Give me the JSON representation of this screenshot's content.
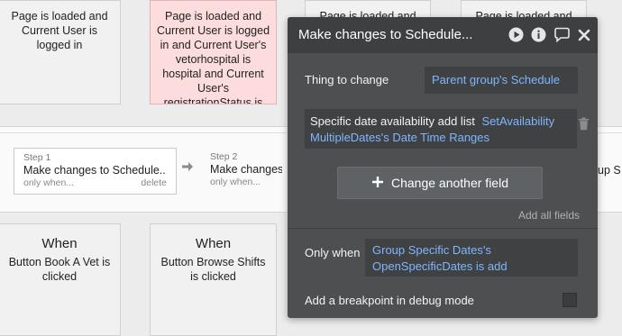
{
  "workflow": {
    "cards_top": [
      {
        "text": "Page is loaded and Current User is logged in",
        "highlight": false
      },
      {
        "text": "Page is loaded and Current User is logged in and Current User's vetorhospital is hospital and Current User's registrationStatus is",
        "highlight": true
      },
      {
        "text": "Page is loaded and",
        "highlight": false
      },
      {
        "text": "Page is loaded and",
        "highlight": false
      }
    ],
    "cards_bottom": [
      {
        "when": "When",
        "event": "Button Book A Vet is clicked"
      },
      {
        "when": "When",
        "event": "Button Browse Shifts is clicked"
      }
    ],
    "steps": [
      {
        "label": "Step 1",
        "name": "Make changes to Schedule...",
        "condition": "only when...",
        "action": "delete"
      },
      {
        "label": "Step 2",
        "name": "Make changes t",
        "condition": "only when..."
      }
    ],
    "right_edge_text": "up S"
  },
  "panel": {
    "title": "Make changes to Schedule...",
    "icons": [
      "play-icon",
      "info-icon",
      "comment-icon",
      "close-icon"
    ],
    "thing_to_change_label": "Thing to change",
    "thing_to_change_value": "Parent group's Schedule",
    "field_name": "Specific date availability add list",
    "field_value_1": "SetAvailability",
    "field_value_2": "MultipleDates's Date Time Ranges",
    "change_another_field": "Change another field",
    "add_all_fields": "Add all fields",
    "only_when_label": "Only when",
    "only_when_value_1": "Group Specific Dates's",
    "only_when_value_2": "OpenSpecificDates is add",
    "breakpoint_label": "Add a breakpoint in debug mode",
    "breakpoint_checked": false
  }
}
